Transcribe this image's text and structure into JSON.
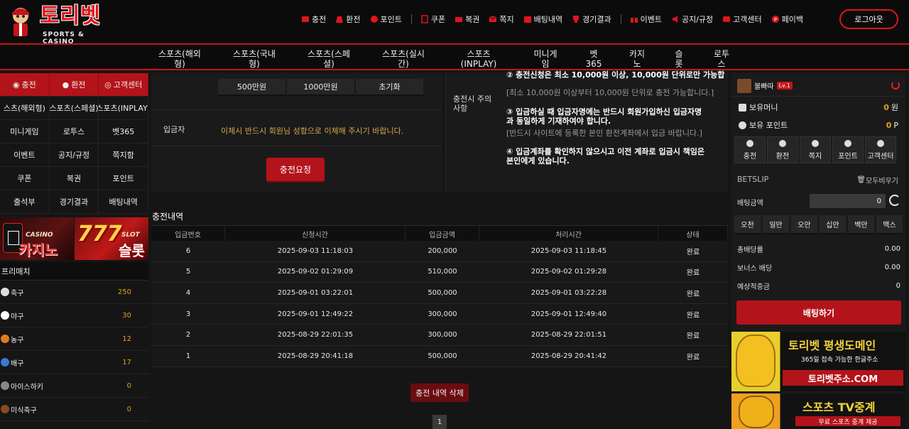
{
  "brand": {
    "name": "토리벳",
    "tagline": "SPORTS & CASINO"
  },
  "colors": {
    "accent": "#c4141a",
    "gold": "#d6a84a",
    "bg": "#151515"
  },
  "top_nav": [
    {
      "icon": "charge-icon",
      "label": "충전"
    },
    {
      "icon": "exchange-icon",
      "label": "환전"
    },
    {
      "icon": "point-icon",
      "label": "포인트"
    },
    {
      "icon": "coupon-icon",
      "label": "쿠폰"
    },
    {
      "icon": "lottery-icon",
      "label": "복권"
    },
    {
      "icon": "message-icon",
      "label": "쪽지"
    },
    {
      "icon": "bet-history-icon",
      "label": "배팅내역"
    },
    {
      "icon": "results-icon",
      "label": "경기결과"
    },
    {
      "icon": "event-icon",
      "label": "이벤트"
    },
    {
      "icon": "notice-icon",
      "label": "공지/규정"
    },
    {
      "icon": "support-icon",
      "label": "고객센터"
    },
    {
      "icon": "paybook-icon",
      "label": "페이백"
    }
  ],
  "logout_label": "로그아웃",
  "main_nav": [
    "스포츠(해외형)",
    "스포츠(국내형)",
    "스포츠(스페셜)",
    "스포츠(실시간)",
    "스포츠(INPLAY)",
    "미니게임",
    "벳365",
    "카지노",
    "슬롯",
    "로투스"
  ],
  "left_menu": {
    "red_row": [
      "충전",
      "환전",
      "고객센터"
    ],
    "rows": [
      [
        "스츠(해외형)",
        "스포츠(스페셜)",
        "스포츠(INPLAY)"
      ],
      [
        "미니게임",
        "로투스",
        "벳365"
      ],
      [
        "이벤트",
        "공지/규정",
        "쪽지함"
      ],
      [
        "쿠폰",
        "복권",
        "포인트"
      ],
      [
        "출석부",
        "경기결과",
        "배팅내역"
      ]
    ]
  },
  "banners": {
    "casino": {
      "sub": "CASINO",
      "title": "카지노"
    },
    "slot": {
      "badge": "777",
      "sub": "SLOT",
      "title": "슬롯"
    }
  },
  "prematch": {
    "title": "프리매치",
    "sports": [
      {
        "name": "축구",
        "count": "250",
        "color": "#dddddd"
      },
      {
        "name": "야구",
        "count": "30",
        "color": "#ffffff"
      },
      {
        "name": "농구",
        "count": "12",
        "color": "#e07a20"
      },
      {
        "name": "배구",
        "count": "17",
        "color": "#3a7ad0"
      },
      {
        "name": "아이스하키",
        "count": "0",
        "color": "#888888"
      },
      {
        "name": "미식축구",
        "count": "0",
        "color": "#8a4a20"
      }
    ]
  },
  "deposit": {
    "amount_buttons": [
      "500만원",
      "1000만원",
      "초기화"
    ],
    "depositor_label": "입금자",
    "depositor_note": "이체시 반드시 회원님 성함으로 이체해 주시기 바랍니다.",
    "submit_label": "충전요청"
  },
  "notice": {
    "label": "충전시 주의사항",
    "lines": [
      {
        "text": "② 충전신청은 최소 10,000원 이상, 10,000원 단위로만 가능합",
        "style": "b"
      },
      {
        "text": "[최소 10,000원 이상부터 10,000원 단위로 충전 가능합니다.]",
        "style": "g"
      },
      {
        "text": "③ 입금하실 때 입금자명에는 반드시 회원가입하신 입금자명",
        "style": "b"
      },
      {
        "text": "과 동일하게 기재하여야 합니다.",
        "style": "b"
      },
      {
        "text": "[반드시 사이트에 등록한 본인 환전계좌에서 입금 바랍니다.]",
        "style": "g"
      },
      {
        "text": "④ 입금계좌를 확인하지 않으시고 이전 계좌로 입금시 책임은",
        "style": "b"
      },
      {
        "text": "본인에게 있습니다.",
        "style": "b"
      }
    ]
  },
  "history": {
    "title": "충전내역",
    "columns": [
      "입금번호",
      "신청시간",
      "입금금액",
      "처리시간",
      "상태"
    ],
    "rows": [
      [
        "6",
        "2025-09-03 11:18:03",
        "200,000",
        "2025-09-03 11:18:45",
        "완료"
      ],
      [
        "5",
        "2025-09-02 01:29:09",
        "510,000",
        "2025-09-02 01:29:28",
        "완료"
      ],
      [
        "4",
        "2025-09-01 03:22:01",
        "500,000",
        "2025-09-01 03:22:28",
        "완료"
      ],
      [
        "3",
        "2025-09-01 12:49:22",
        "300,000",
        "2025-09-01 12:49:40",
        "완료"
      ],
      [
        "2",
        "2025-08-29 22:01:35",
        "300,000",
        "2025-08-29 22:01:51",
        "완료"
      ],
      [
        "1",
        "2025-08-29 20:41:18",
        "500,000",
        "2025-08-29 20:41:42",
        "완료"
      ]
    ],
    "delete_label": "충전 내역 삭제",
    "page": "1"
  },
  "user": {
    "name": "볼빠따",
    "level": "Lv.1",
    "money_label": "보유머니",
    "money_value": "0",
    "money_unit": "원",
    "point_label": "보유 포인트",
    "point_value": "0",
    "point_unit": "P"
  },
  "quick_buttons": [
    "충전",
    "환전",
    "쪽지",
    "포인트",
    "고객센터"
  ],
  "betslip": {
    "title": "BETSLIP",
    "clear_label": "모두비우기",
    "amount_label": "배팅금액",
    "amount_value": "0",
    "chips": [
      "오천",
      "일만",
      "오만",
      "십만",
      "백만",
      "맥스"
    ],
    "summary": [
      {
        "label": "총배당률",
        "value": "0.00"
      },
      {
        "label": "보너스 배당",
        "value": "0.00"
      },
      {
        "label": "예상적중금",
        "value": "0"
      }
    ],
    "bet_label": "배팅하기"
  },
  "promos": {
    "domain": {
      "title": "토리벳 평생도메인",
      "sub": "365일 접속 가능한 한글주소",
      "url": "토리벳주소.COM"
    },
    "tv": {
      "title": "스포츠 TV중계",
      "sub": "무료 스포츠 중계 제공"
    }
  }
}
